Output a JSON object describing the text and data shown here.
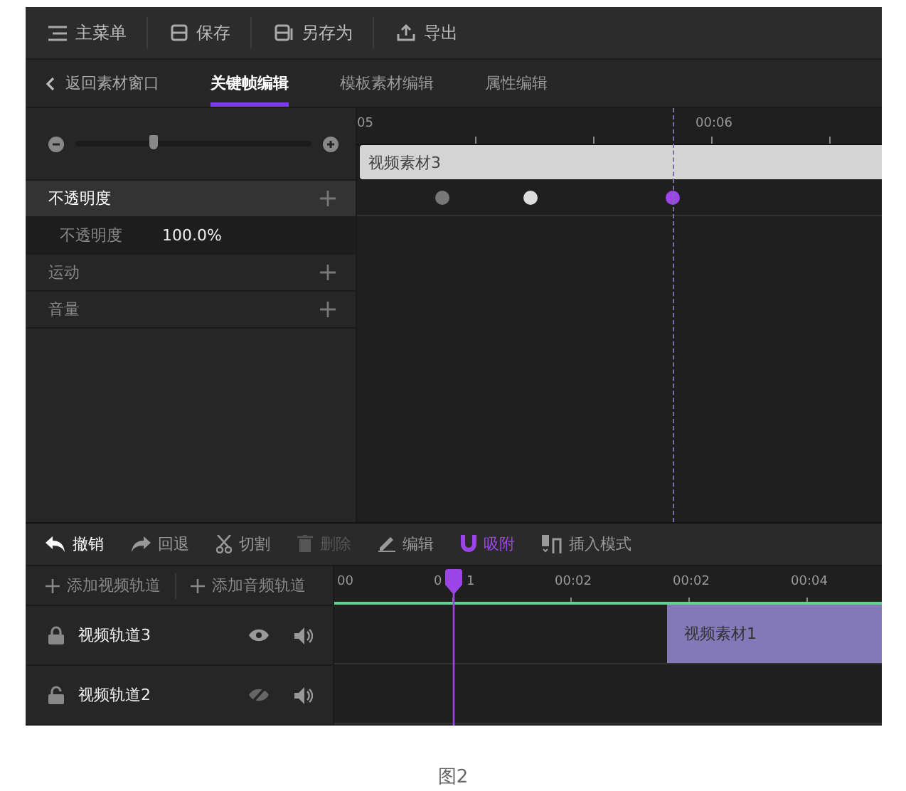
{
  "menu": [
    {
      "kind": "menu",
      "label": "主菜单"
    },
    {
      "kind": "save",
      "label": "保存"
    },
    {
      "kind": "saveas",
      "label": "另存为"
    },
    {
      "kind": "export",
      "label": "导出"
    }
  ],
  "tabs": {
    "back": "返回素材窗口",
    "items": [
      {
        "label": "关键帧编辑",
        "selected": true
      },
      {
        "label": "模板素材编辑",
        "selected": false
      },
      {
        "label": "属性编辑",
        "selected": false
      }
    ]
  },
  "zoom_slider": {
    "level": 0.33
  },
  "properties": [
    {
      "kind": "group",
      "label": "不透明度",
      "selected": true
    },
    {
      "kind": "value",
      "label": "不透明度",
      "value": "100.0%"
    },
    {
      "kind": "group",
      "label": "运动",
      "selected": false
    },
    {
      "kind": "group",
      "label": "音量",
      "selected": false
    }
  ],
  "keyframe_timeline": {
    "ruler": [
      "05",
      "00:06"
    ],
    "clip": "视频素材3",
    "keyframes": [
      {
        "color": "#777777"
      },
      {
        "color": "#dddddd"
      },
      {
        "color": "#9b45e6"
      }
    ]
  },
  "edit_toolbar": [
    {
      "kind": "undo",
      "label": "撤销",
      "disabled": false,
      "on": false
    },
    {
      "kind": "redo",
      "label": "回退",
      "disabled": false,
      "on": false
    },
    {
      "kind": "cut",
      "label": "切割",
      "disabled": false,
      "on": false
    },
    {
      "kind": "delete",
      "label": "删除",
      "disabled": true,
      "on": false
    },
    {
      "kind": "edit",
      "label": "编辑",
      "disabled": false,
      "on": false
    },
    {
      "kind": "snap",
      "label": "吸附",
      "disabled": false,
      "on": true
    },
    {
      "kind": "insert",
      "label": "插入模式",
      "disabled": false,
      "on": false
    }
  ],
  "tracks": {
    "add_buttons": [
      "添加视频轨道",
      "添加音频轨道"
    ],
    "ruler": [
      "00",
      "0",
      "1",
      "00:02",
      "00:02",
      "00:04"
    ],
    "rows": [
      {
        "name": "视频轨道3",
        "locked": true,
        "visible": true,
        "clip": "视频素材1"
      },
      {
        "name": "视频轨道2",
        "locked": false,
        "visible": false
      }
    ]
  },
  "caption": "图2"
}
